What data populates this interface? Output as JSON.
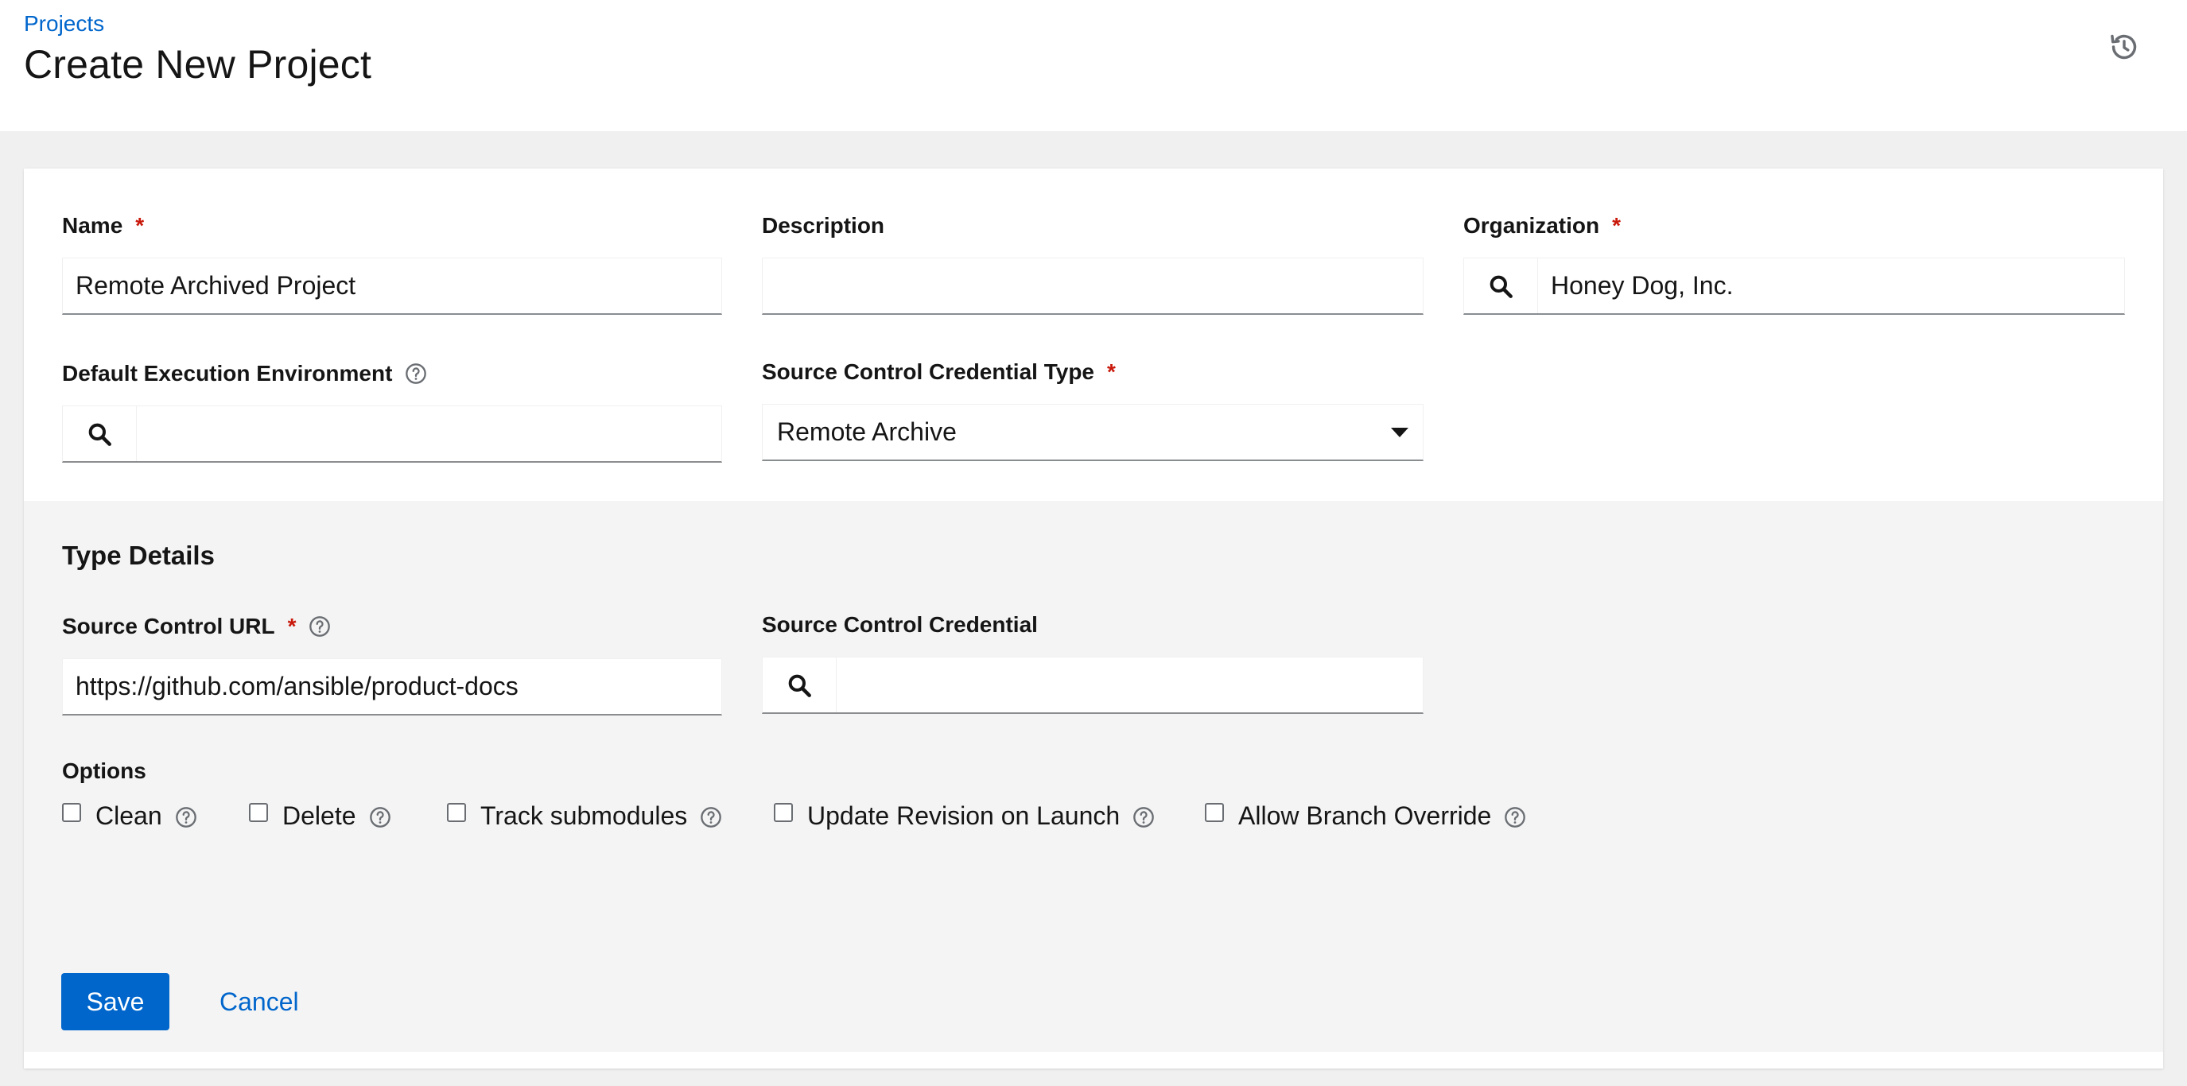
{
  "header": {
    "breadcrumb": "Projects",
    "title": "Create New Project",
    "history_icon": "history-icon"
  },
  "form": {
    "name": {
      "label": "Name",
      "required": "*",
      "value": "Remote Archived Project"
    },
    "description": {
      "label": "Description",
      "value": ""
    },
    "organization": {
      "label": "Organization",
      "required": "*",
      "value": "Honey Dog, Inc."
    },
    "execution_environment": {
      "label": "Default Execution Environment",
      "value": ""
    },
    "credential_type": {
      "label": "Source Control Credential Type",
      "required": "*",
      "selected": "Remote Archive"
    }
  },
  "type_details": {
    "title": "Type Details",
    "url": {
      "label": "Source Control URL",
      "required": "*",
      "value": "https://github.com/ansible/product-docs"
    },
    "credential": {
      "label": "Source Control Credential",
      "value": ""
    },
    "options_label": "Options",
    "options": [
      {
        "label": "Clean",
        "checked": false
      },
      {
        "label": "Delete",
        "checked": false
      },
      {
        "label": "Track submodules",
        "checked": false
      },
      {
        "label": "Update Revision on Launch",
        "checked": false
      },
      {
        "label": "Allow Branch Override",
        "checked": false
      }
    ]
  },
  "actions": {
    "save": "Save",
    "cancel": "Cancel"
  },
  "colors": {
    "accent": "#0066cc",
    "required": "#c9190b",
    "page_bg": "#f0f0f0",
    "section_bg": "#f4f4f4"
  }
}
